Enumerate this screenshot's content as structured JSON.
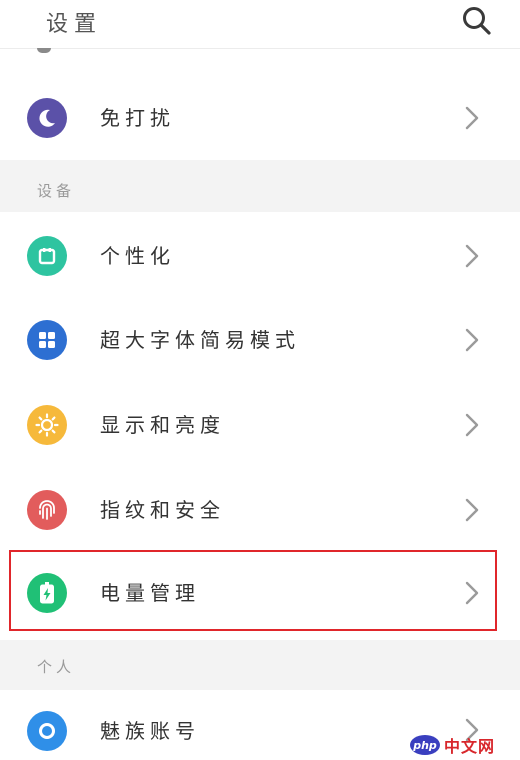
{
  "header": {
    "title": "设置"
  },
  "rows": {
    "dnd": {
      "label": "免打扰",
      "color": "#5b51a8",
      "icon": "moon-icon"
    },
    "personalize": {
      "label": "个性化",
      "color": "#2ec4a0",
      "icon": "calendar-icon"
    },
    "bigfont": {
      "label": "超大字体简易模式",
      "color": "#2d6fd2",
      "icon": "grid-icon"
    },
    "display": {
      "label": "显示和亮度",
      "color": "#f6b93b",
      "icon": "sun-icon"
    },
    "fingerprint": {
      "label": "指纹和安全",
      "color": "#e25c5c",
      "icon": "fingerprint-icon"
    },
    "battery": {
      "label": "电量管理",
      "color": "#20c076",
      "icon": "battery-icon"
    },
    "account": {
      "label": "魅族账号",
      "color": "#2f8fe8",
      "icon": "account-icon"
    }
  },
  "sections": {
    "device": "设备",
    "personal": "个人"
  },
  "highlight_color": "#e0262b",
  "watermark": {
    "logo": "php",
    "text": "中文网"
  }
}
